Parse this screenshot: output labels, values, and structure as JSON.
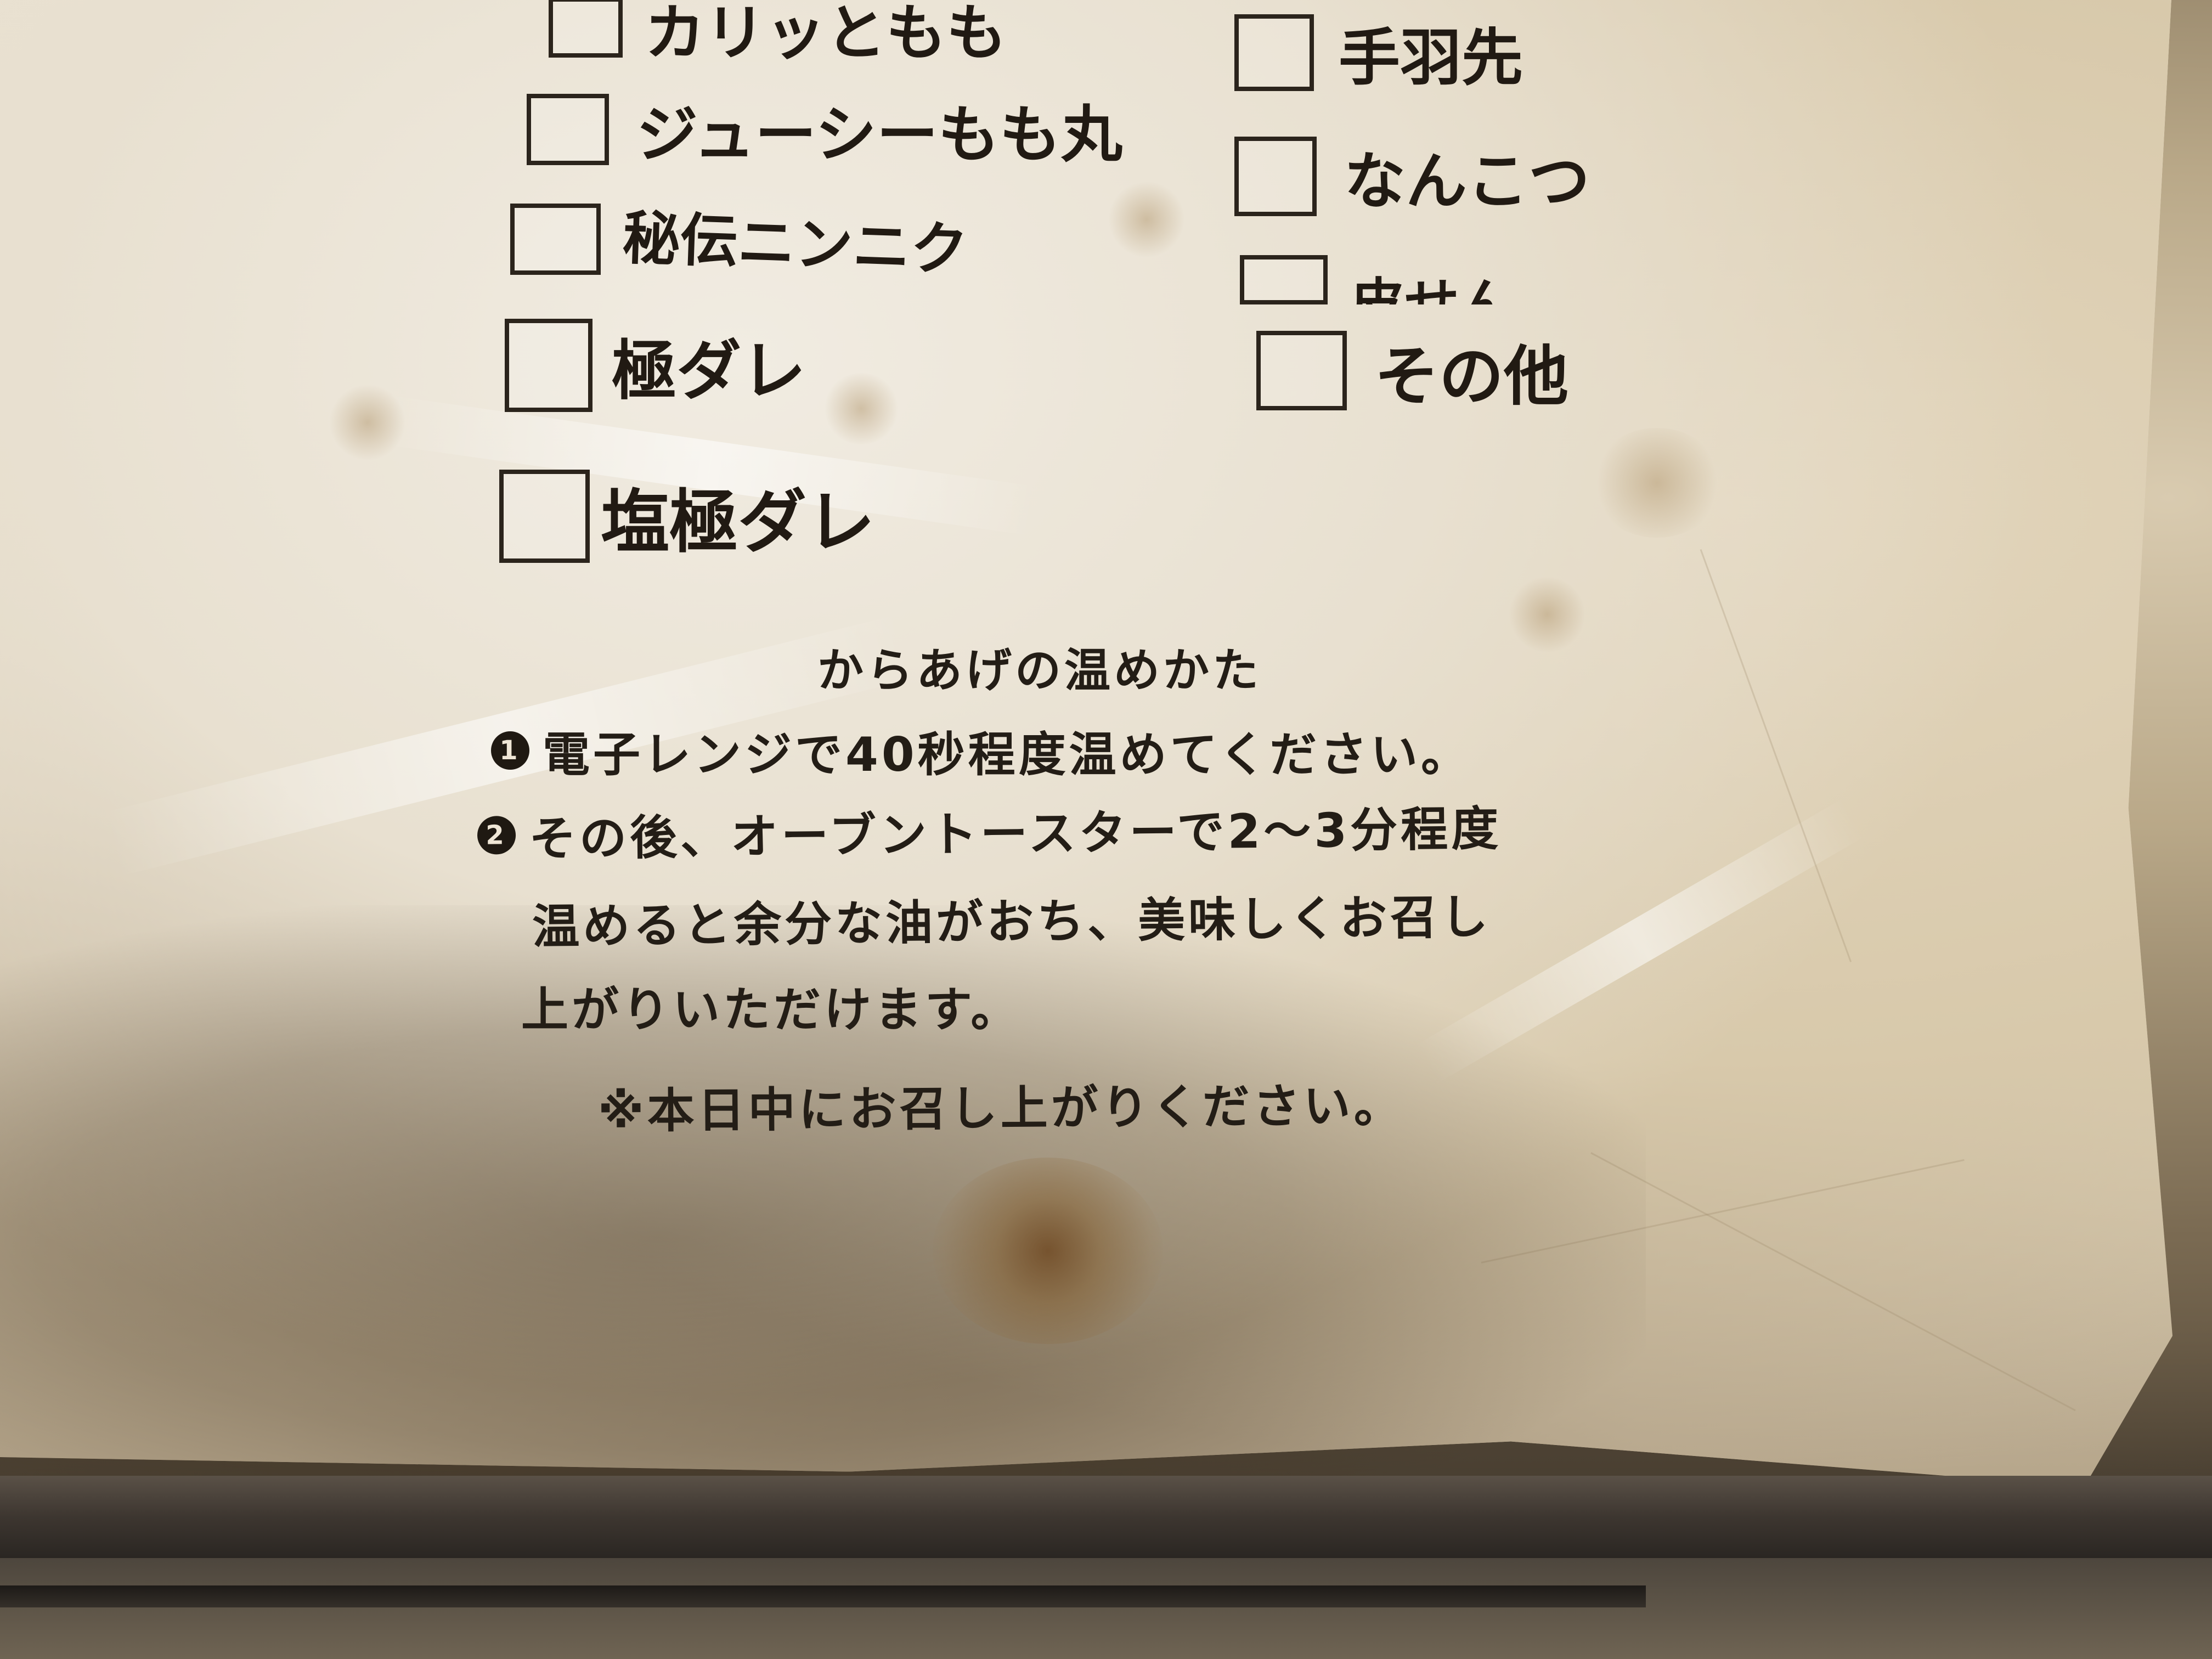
{
  "menu_items": [
    {
      "label": "カリッともも"
    },
    {
      "label": "手羽先"
    },
    {
      "label": "ジューシーもも丸"
    },
    {
      "label": "なんこつ"
    },
    {
      "label": "秘伝ニンニク"
    },
    {
      "label": "皮せん"
    },
    {
      "label": "極ダレ"
    },
    {
      "label": "その他"
    },
    {
      "label": "塩極ダレ"
    }
  ],
  "reheat": {
    "title": "からあげの温めかた",
    "step1_num": "1",
    "step1": "電子レンジで40秒程度温めてください。",
    "step2_num": "2",
    "step2_line1": "その後、オーブントースターで2〜3分程度",
    "step2_line2": "温めると余分な油がおち、美味しくお召し",
    "step2_line3": "上がりいただけます。",
    "note": "※本日中にお召し上がりください。"
  }
}
